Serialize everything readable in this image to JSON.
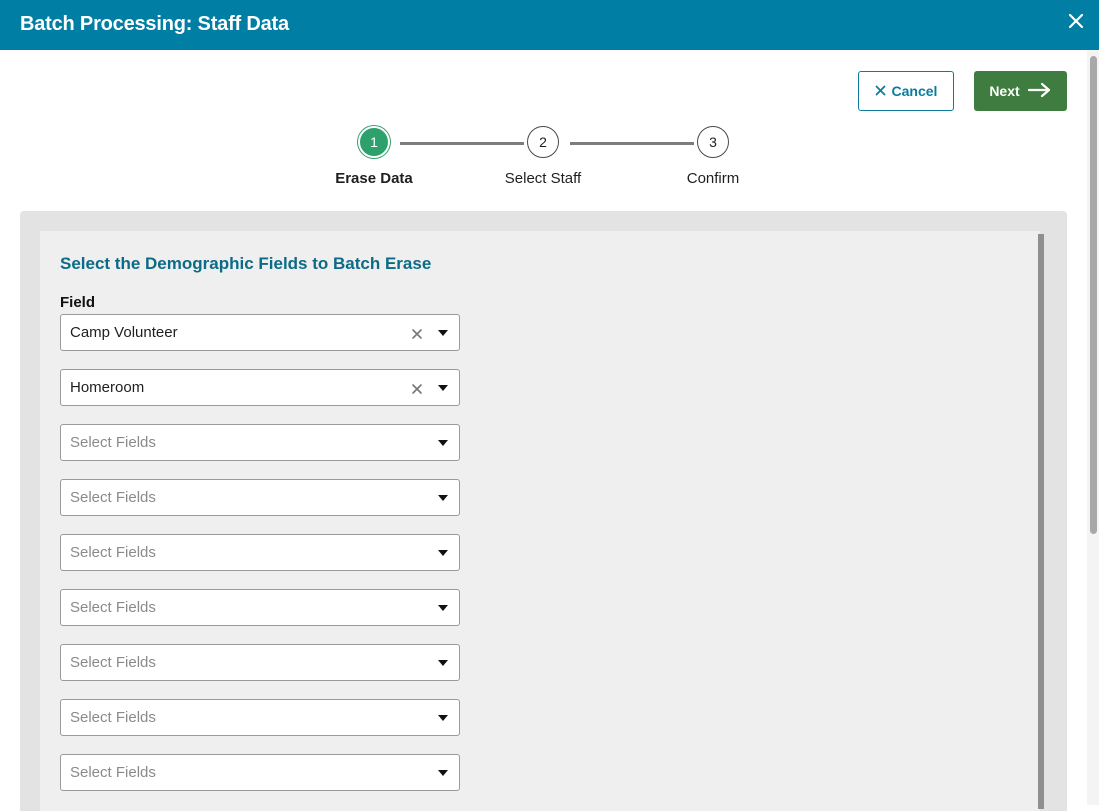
{
  "dialog": {
    "title": "Batch Processing: Staff Data",
    "close_icon": "close-icon"
  },
  "actions": {
    "cancel_label": "Cancel",
    "cancel_icon": "x-icon",
    "next_label": "Next",
    "next_icon": "arrow-right-icon"
  },
  "stepper": {
    "active_step": 1,
    "steps": [
      {
        "number": "1",
        "label": "Erase Data"
      },
      {
        "number": "2",
        "label": "Select Staff"
      },
      {
        "number": "3",
        "label": "Confirm"
      }
    ],
    "active_color": "#2ea06b"
  },
  "form": {
    "heading": "Select the Demographic Fields to Batch Erase",
    "field_label": "Field",
    "fields": [
      {
        "value": "Camp Volunteer",
        "placeholder": false,
        "clearable": true
      },
      {
        "value": "Homeroom",
        "placeholder": false,
        "clearable": true
      },
      {
        "value": "Select Fields",
        "placeholder": true,
        "clearable": false
      },
      {
        "value": "Select Fields",
        "placeholder": true,
        "clearable": false
      },
      {
        "value": "Select Fields",
        "placeholder": true,
        "clearable": false
      },
      {
        "value": "Select Fields",
        "placeholder": true,
        "clearable": false
      },
      {
        "value": "Select Fields",
        "placeholder": true,
        "clearable": false
      },
      {
        "value": "Select Fields",
        "placeholder": true,
        "clearable": false
      },
      {
        "value": "Select Fields",
        "placeholder": true,
        "clearable": false
      }
    ]
  },
  "colors": {
    "header": "#007ea4",
    "next_button": "#3e7d3f",
    "heading_text": "#0c6b86"
  }
}
